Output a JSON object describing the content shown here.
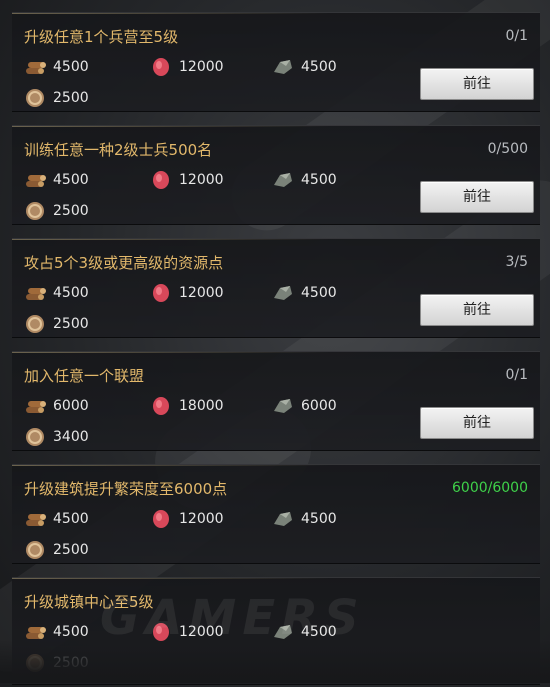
{
  "watermark": "GAMERS",
  "tasks": [
    {
      "title": "升级任意1个兵营至5级",
      "progress": "0/1",
      "resources": {
        "wood": "4500",
        "meat": "12000",
        "stone": "4500",
        "coin": "2500"
      },
      "button": "前往"
    },
    {
      "title": "训练任意一种2级士兵500名",
      "progress": "0/500",
      "resources": {
        "wood": "4500",
        "meat": "12000",
        "stone": "4500",
        "coin": "2500"
      },
      "button": "前往"
    },
    {
      "title": "攻占5个3级或更高级的资源点",
      "progress": "3/5",
      "resources": {
        "wood": "4500",
        "meat": "12000",
        "stone": "4500",
        "coin": "2500"
      },
      "button": "前往"
    },
    {
      "title": "加入任意一个联盟",
      "progress": "0/1",
      "resources": {
        "wood": "6000",
        "meat": "18000",
        "stone": "6000",
        "coin": "3400"
      },
      "button": "前往"
    },
    {
      "title": "升级建筑提升繁荣度至6000点",
      "progress": "6000/6000",
      "resources": {
        "wood": "4500",
        "meat": "12000",
        "stone": "4500",
        "coin": "2500"
      },
      "button": ""
    },
    {
      "title": "升级城镇中心至5级",
      "progress": "",
      "resources": {
        "wood": "4500",
        "meat": "12000",
        "stone": "4500",
        "coin": "2500"
      },
      "button": ""
    }
  ],
  "colors": {
    "title": "#e2b86b",
    "complete": "#3fd14a",
    "progress": "#b9bcc0"
  },
  "icons": [
    "wood-logs-icon",
    "meat-icon",
    "stone-ore-icon",
    "gold-coin-icon"
  ]
}
